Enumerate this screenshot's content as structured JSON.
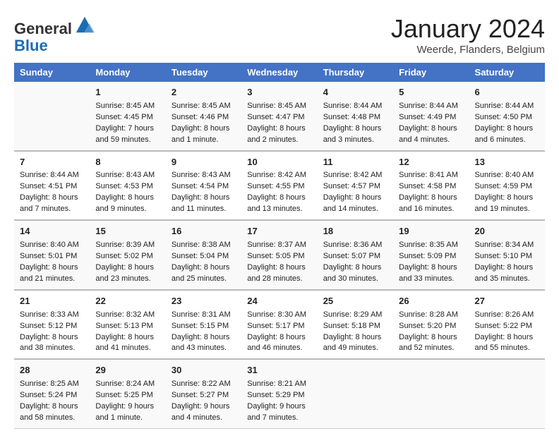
{
  "header": {
    "logo_general": "General",
    "logo_blue": "Blue",
    "month": "January 2024",
    "location": "Weerde, Flanders, Belgium"
  },
  "days_of_week": [
    "Sunday",
    "Monday",
    "Tuesday",
    "Wednesday",
    "Thursday",
    "Friday",
    "Saturday"
  ],
  "weeks": [
    [
      {
        "day": "",
        "info": ""
      },
      {
        "day": "1",
        "info": "Sunrise: 8:45 AM\nSunset: 4:45 PM\nDaylight: 7 hours\nand 59 minutes."
      },
      {
        "day": "2",
        "info": "Sunrise: 8:45 AM\nSunset: 4:46 PM\nDaylight: 8 hours\nand 1 minute."
      },
      {
        "day": "3",
        "info": "Sunrise: 8:45 AM\nSunset: 4:47 PM\nDaylight: 8 hours\nand 2 minutes."
      },
      {
        "day": "4",
        "info": "Sunrise: 8:44 AM\nSunset: 4:48 PM\nDaylight: 8 hours\nand 3 minutes."
      },
      {
        "day": "5",
        "info": "Sunrise: 8:44 AM\nSunset: 4:49 PM\nDaylight: 8 hours\nand 4 minutes."
      },
      {
        "day": "6",
        "info": "Sunrise: 8:44 AM\nSunset: 4:50 PM\nDaylight: 8 hours\nand 6 minutes."
      }
    ],
    [
      {
        "day": "7",
        "info": "Sunrise: 8:44 AM\nSunset: 4:51 PM\nDaylight: 8 hours\nand 7 minutes."
      },
      {
        "day": "8",
        "info": "Sunrise: 8:43 AM\nSunset: 4:53 PM\nDaylight: 8 hours\nand 9 minutes."
      },
      {
        "day": "9",
        "info": "Sunrise: 8:43 AM\nSunset: 4:54 PM\nDaylight: 8 hours\nand 11 minutes."
      },
      {
        "day": "10",
        "info": "Sunrise: 8:42 AM\nSunset: 4:55 PM\nDaylight: 8 hours\nand 13 minutes."
      },
      {
        "day": "11",
        "info": "Sunrise: 8:42 AM\nSunset: 4:57 PM\nDaylight: 8 hours\nand 14 minutes."
      },
      {
        "day": "12",
        "info": "Sunrise: 8:41 AM\nSunset: 4:58 PM\nDaylight: 8 hours\nand 16 minutes."
      },
      {
        "day": "13",
        "info": "Sunrise: 8:40 AM\nSunset: 4:59 PM\nDaylight: 8 hours\nand 19 minutes."
      }
    ],
    [
      {
        "day": "14",
        "info": "Sunrise: 8:40 AM\nSunset: 5:01 PM\nDaylight: 8 hours\nand 21 minutes."
      },
      {
        "day": "15",
        "info": "Sunrise: 8:39 AM\nSunset: 5:02 PM\nDaylight: 8 hours\nand 23 minutes."
      },
      {
        "day": "16",
        "info": "Sunrise: 8:38 AM\nSunset: 5:04 PM\nDaylight: 8 hours\nand 25 minutes."
      },
      {
        "day": "17",
        "info": "Sunrise: 8:37 AM\nSunset: 5:05 PM\nDaylight: 8 hours\nand 28 minutes."
      },
      {
        "day": "18",
        "info": "Sunrise: 8:36 AM\nSunset: 5:07 PM\nDaylight: 8 hours\nand 30 minutes."
      },
      {
        "day": "19",
        "info": "Sunrise: 8:35 AM\nSunset: 5:09 PM\nDaylight: 8 hours\nand 33 minutes."
      },
      {
        "day": "20",
        "info": "Sunrise: 8:34 AM\nSunset: 5:10 PM\nDaylight: 8 hours\nand 35 minutes."
      }
    ],
    [
      {
        "day": "21",
        "info": "Sunrise: 8:33 AM\nSunset: 5:12 PM\nDaylight: 8 hours\nand 38 minutes."
      },
      {
        "day": "22",
        "info": "Sunrise: 8:32 AM\nSunset: 5:13 PM\nDaylight: 8 hours\nand 41 minutes."
      },
      {
        "day": "23",
        "info": "Sunrise: 8:31 AM\nSunset: 5:15 PM\nDaylight: 8 hours\nand 43 minutes."
      },
      {
        "day": "24",
        "info": "Sunrise: 8:30 AM\nSunset: 5:17 PM\nDaylight: 8 hours\nand 46 minutes."
      },
      {
        "day": "25",
        "info": "Sunrise: 8:29 AM\nSunset: 5:18 PM\nDaylight: 8 hours\nand 49 minutes."
      },
      {
        "day": "26",
        "info": "Sunrise: 8:28 AM\nSunset: 5:20 PM\nDaylight: 8 hours\nand 52 minutes."
      },
      {
        "day": "27",
        "info": "Sunrise: 8:26 AM\nSunset: 5:22 PM\nDaylight: 8 hours\nand 55 minutes."
      }
    ],
    [
      {
        "day": "28",
        "info": "Sunrise: 8:25 AM\nSunset: 5:24 PM\nDaylight: 8 hours\nand 58 minutes."
      },
      {
        "day": "29",
        "info": "Sunrise: 8:24 AM\nSunset: 5:25 PM\nDaylight: 9 hours\nand 1 minute."
      },
      {
        "day": "30",
        "info": "Sunrise: 8:22 AM\nSunset: 5:27 PM\nDaylight: 9 hours\nand 4 minutes."
      },
      {
        "day": "31",
        "info": "Sunrise: 8:21 AM\nSunset: 5:29 PM\nDaylight: 9 hours\nand 7 minutes."
      },
      {
        "day": "",
        "info": ""
      },
      {
        "day": "",
        "info": ""
      },
      {
        "day": "",
        "info": ""
      }
    ]
  ]
}
